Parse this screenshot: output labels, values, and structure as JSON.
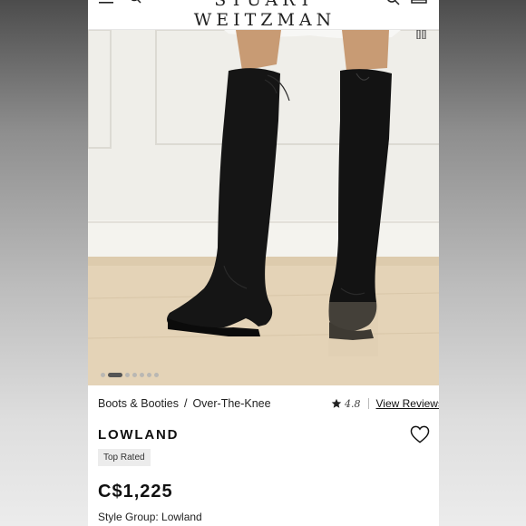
{
  "header": {
    "brand": "STUART WEITZMAN"
  },
  "product": {
    "breadcrumb": [
      "Boots & Booties",
      "Over-The-Knee"
    ],
    "breadcrumb_separator": "/",
    "rating": "4.8",
    "reviews_link": "View Reviews",
    "name": "LOWLAND",
    "badge": "Top Rated",
    "price": "C$1,225",
    "style_group": "Style Group: Lowland"
  },
  "carousel": {
    "slide_count": 7,
    "active_slide": 2
  },
  "icons": [
    "menu-icon",
    "search-icon",
    "bag-icon",
    "pause-icon",
    "star-icon",
    "heart-icon"
  ],
  "colors": {
    "text": "#1a1a1a",
    "badge_bg": "#ececec",
    "boot": "#141414"
  }
}
